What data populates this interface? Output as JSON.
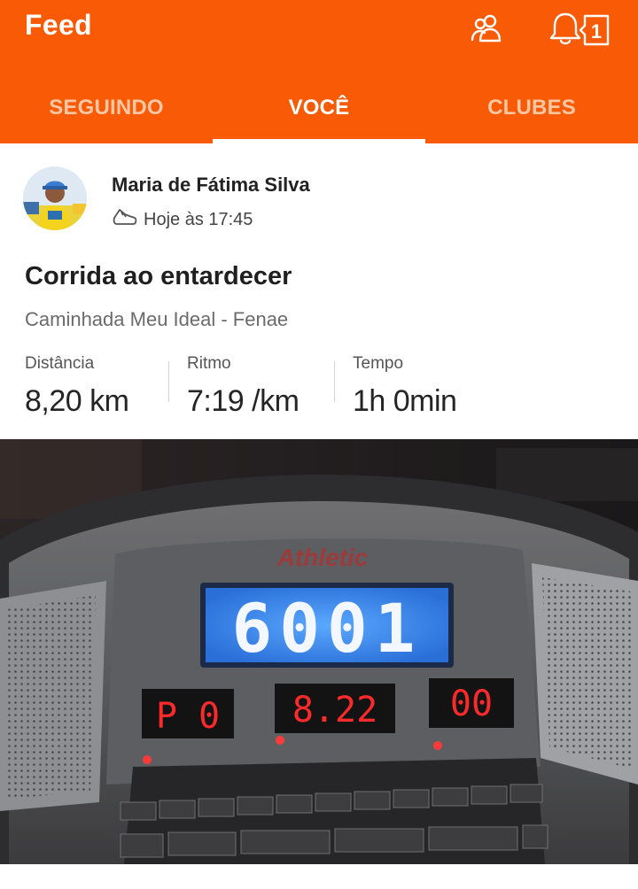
{
  "header": {
    "title": "Feed",
    "icons": [
      "people-icon",
      "bell-icon"
    ],
    "notification_count": "1"
  },
  "tabs": [
    {
      "label": "SEGUINDO",
      "active": false
    },
    {
      "label": "VOCÊ",
      "active": true
    },
    {
      "label": "CLUBES",
      "active": false
    }
  ],
  "activity": {
    "athlete_name": "Maria de Fátima Silva",
    "time": "Hoje às 17:45",
    "type_icon": "shoe-icon",
    "title": "Corrida ao entardecer",
    "subtitle": "Caminhada Meu Ideal - Fenae",
    "stats": [
      {
        "label": "Distância",
        "value": "8,20 km"
      },
      {
        "label": "Ritmo",
        "value": "7:19 /km"
      },
      {
        "label": "Tempo",
        "value": "1h 0min"
      }
    ]
  },
  "photo": {
    "brand": "Athletic",
    "lcd_text": "6001",
    "led_left": "P 0",
    "led_center": "8.22",
    "led_right": "00"
  },
  "colors": {
    "accent": "#f85a05",
    "tab_inactive": "#ffc7a3",
    "lcd_blue": "#3b8cff",
    "led_red": "#ff2a2a"
  }
}
